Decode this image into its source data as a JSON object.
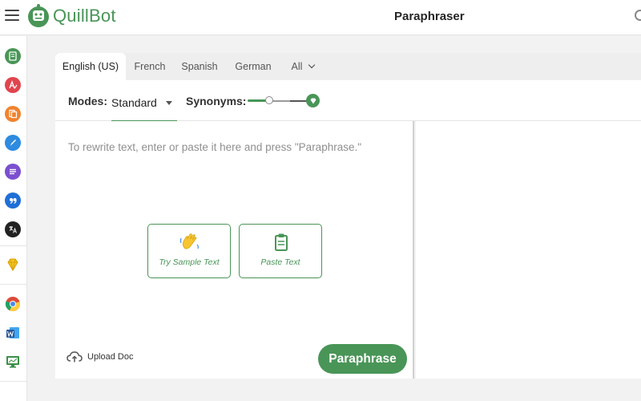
{
  "header": {
    "brand": "QuillBot",
    "title": "Paraphraser"
  },
  "sidebar": {
    "items": [
      {
        "name": "paraphraser",
        "icon": "document-icon",
        "color": "#499557"
      },
      {
        "name": "grammar-checker",
        "icon": "grammar-icon",
        "color": "#e0454e"
      },
      {
        "name": "plagiarism-checker",
        "icon": "plagiarism-icon",
        "color": "#f0832f"
      },
      {
        "name": "co-writer",
        "icon": "pen-icon",
        "color": "#2d8be0"
      },
      {
        "name": "summarizer",
        "icon": "lines-icon",
        "color": "#7b4fcf"
      },
      {
        "name": "citation-generator",
        "icon": "quote-icon",
        "color": "#1f6fd6"
      },
      {
        "name": "translator",
        "icon": "translate-icon",
        "color": "#222222"
      },
      {
        "name": "premium",
        "icon": "diamond-icon",
        "color": "#e2b400"
      },
      {
        "name": "chrome-extension",
        "icon": "chrome-icon",
        "color": "#dd4b39"
      },
      {
        "name": "word-addin",
        "icon": "word-icon",
        "color": "#2b5797"
      },
      {
        "name": "desktop-app",
        "icon": "monitor-icon",
        "color": "#3a8f48"
      }
    ]
  },
  "languages": {
    "tabs": [
      "English (US)",
      "French",
      "Spanish",
      "German"
    ],
    "all_label": "All",
    "active": "English (US)"
  },
  "modes": {
    "label": "Modes:",
    "selected": "Standard",
    "synonyms_label": "Synonyms:",
    "synonyms_level": 0.3
  },
  "editor": {
    "placeholder": "To rewrite text, enter or paste it here and press \"Paraphrase.\"",
    "sample_label": "Try Sample Text",
    "paste_label": "Paste Text",
    "upload_label": "Upload Doc",
    "paraphrase_label": "Paraphrase"
  },
  "colors": {
    "accent": "#499557"
  }
}
